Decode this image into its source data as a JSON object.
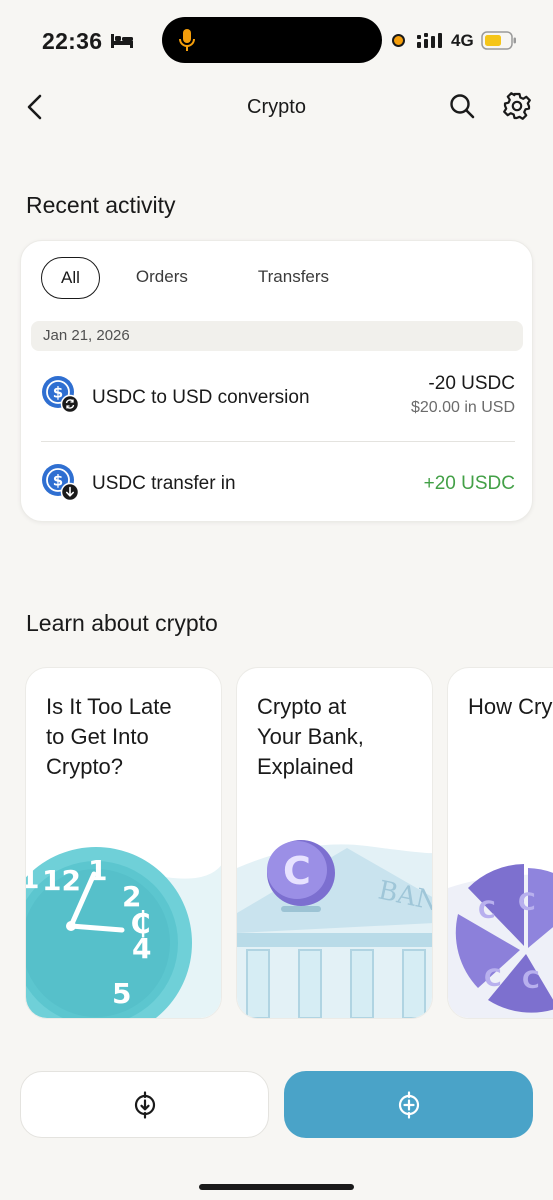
{
  "status_bar": {
    "time": "22:36",
    "network": "4G",
    "icons": [
      "bed-icon",
      "microphone-icon",
      "recording-dot-icon",
      "signal-icon",
      "battery-icon"
    ],
    "colors": {
      "mic": "#f59e0b",
      "battery": "#f5c518"
    }
  },
  "nav": {
    "title": "Crypto",
    "icons": [
      "chevron-left-icon",
      "search-icon",
      "gear-icon"
    ]
  },
  "recent_activity": {
    "heading": "Recent activity",
    "tabs": [
      {
        "label": "All",
        "active": true
      },
      {
        "label": "Orders",
        "active": false
      },
      {
        "label": "Transfers",
        "active": false
      }
    ],
    "date": "Jan 21, 2026",
    "items": [
      {
        "label": "USDC to USD conversion",
        "amount": "-20 USDC",
        "sub_amount": "$20.00 in USD",
        "icon": "usdc-convert-icon"
      },
      {
        "label": "USDC transfer in",
        "amount": "+20 USDC",
        "icon": "usdc-receive-icon"
      }
    ],
    "colors": {
      "coin": "#2f6fd1",
      "positive": "#43a047"
    }
  },
  "learn": {
    "heading": "Learn about crypto",
    "cards": [
      {
        "title": "Is It Too Late\nto Get Into\nCrypto?",
        "illustration": "clock-illustration"
      },
      {
        "title": "Crypto at\nYour Bank,\nExplained",
        "illustration": "bank-coin-illustration"
      },
      {
        "title": "How Cry\nFits Into\nPortfolio",
        "illustration": "coin-pie-illustration"
      }
    ]
  },
  "actions": {
    "receive_icon": "coin-receive-icon",
    "buy_icon": "coin-add-icon",
    "colors": {
      "buy": "#4aa3c8"
    }
  }
}
